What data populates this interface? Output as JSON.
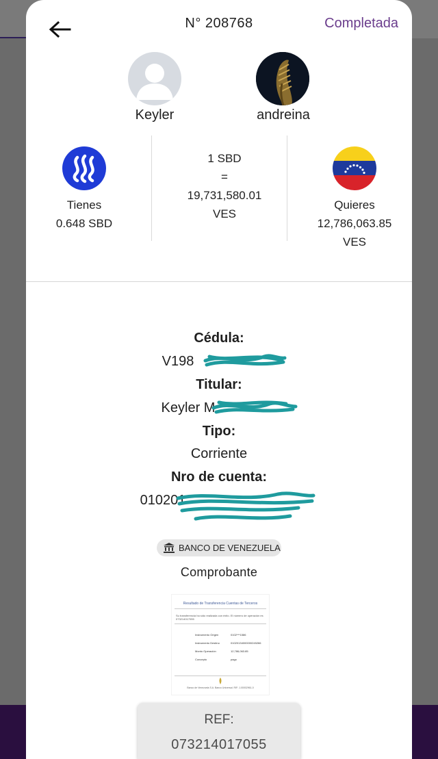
{
  "header": {
    "order_number": "N° 208768",
    "status": "Completada",
    "status_color": "#6a3c8c"
  },
  "users": {
    "sender": {
      "name": "Keyler",
      "avatar_icon": "default-person-avatar"
    },
    "receiver": {
      "name": "andreina",
      "avatar_icon": "golden-wing-photo"
    }
  },
  "exchange": {
    "have_label": "Tienes",
    "have_amount": "0.648 SBD",
    "have_icon": "steem-logo",
    "rate_line1": "1 SBD",
    "rate_line2": "=",
    "rate_line3": "19,731,580.01",
    "rate_line4": "VES",
    "want_label": "Quieres",
    "want_amount": "12,786,063.85",
    "want_currency": "VES",
    "want_icon": "venezuela-flag"
  },
  "account": {
    "id_label": "Cédula:",
    "id_value": "V198",
    "holder_label": "Titular:",
    "holder_value": "Keyler M",
    "type_label": "Tipo:",
    "type_value": "Corriente",
    "number_label": "Nro de cuenta:",
    "number_value": "010201",
    "bank_name": "BANCO DE VENEZUELA",
    "bank_icon": "bank-icon"
  },
  "voucher": {
    "label": "Comprobante",
    "title": "Resultado de Transferencia Cuentas de Terceros",
    "message": "Su transferencia ha sido realizada con éxito. El número de operación es 073214017055",
    "rows": [
      {
        "k": "Instrumento Origen",
        "v": "0102***1586"
      },
      {
        "k": "Instrumento Destino",
        "v": "01020134000000245266"
      },
      {
        "k": "Monto Operación",
        "v": "12,786,063.85"
      },
      {
        "k": "Concepto",
        "v": "pago"
      }
    ],
    "footer": "Banco de Venezuela S.A. Banco Universal. RIF: J-00002961-0"
  },
  "reference": {
    "label": "REF:",
    "value": "073214017055"
  }
}
